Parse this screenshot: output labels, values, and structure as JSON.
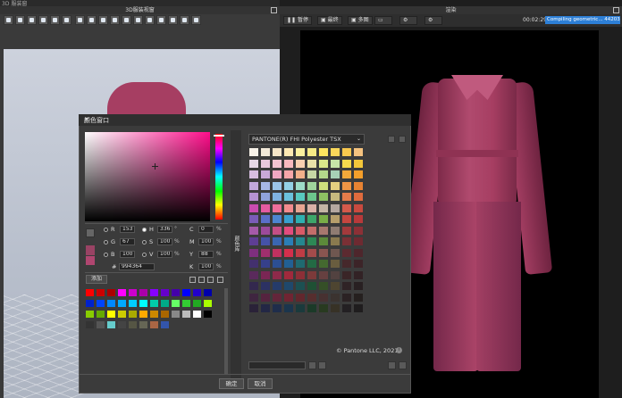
{
  "app": {
    "title": "3D 服装窗"
  },
  "windows": {
    "left_title": "3D服装视窗",
    "render_title": "渲染"
  },
  "render_toolbar": {
    "pause": "暂停",
    "final": "最终",
    "multi": "多图",
    "time": "00:02:29",
    "status": "Compiling geometric... 44203/44203"
  },
  "dialog": {
    "title": "颜色窗口",
    "close": "✕",
    "hsv": {
      "r_label": "R",
      "r": "153",
      "g_label": "G",
      "g": "67",
      "b_label": "B",
      "b": "100",
      "h_label": "H",
      "h": "336",
      "s_label": "S",
      "s": "100",
      "v_label": "V",
      "v": "100"
    },
    "cmyk": {
      "c_label": "C",
      "c": "0",
      "m_label": "M",
      "m": "100",
      "y_label": "Y",
      "y": "88",
      "k_label": "K",
      "k": "100"
    },
    "pct": "%",
    "hash": "#",
    "hex": "994364",
    "add": "添加",
    "ok": "确定",
    "cancel": "取消",
    "side_tab": "颜色库",
    "pantone_library": "PANTONE(R) FHI Polyester TSX",
    "pantone_copyright": "© Pantone LLC, 2021",
    "info_glyph": "i"
  },
  "colors": {
    "current": "#994364",
    "previous": "#b04670",
    "accent_blue": "#2d7fd6"
  },
  "swatches": [
    "#ff0000",
    "#cc0000",
    "#aa0000",
    "#ff00ff",
    "#cc00cc",
    "#aa00aa",
    "#8800ff",
    "#6600cc",
    "#4400aa",
    "#0000ff",
    "#2200cc",
    "#0000aa",
    "#0022cc",
    "#0044ff",
    "#0088ff",
    "#00aaff",
    "#00ccff",
    "#00ffff",
    "#00ccaa",
    "#00aa88",
    "#66ff66",
    "#33cc33",
    "#22aa22",
    "#aaff00",
    "#88cc00",
    "#66aa00",
    "#ffff00",
    "#cccc00",
    "#aaaa00",
    "#ffaa00",
    "#cc8800",
    "#aa6600",
    "#888888",
    "#bbbbbb",
    "#ffffff",
    "#000000",
    "#333333",
    "#555555",
    "#66cccc",
    "#444444",
    "#555544",
    "#666655",
    "#aa6644",
    "#3355aa"
  ],
  "pantone": [
    "#f7f2e8",
    "#f2e9d8",
    "#f6e6c8",
    "#fde9b2",
    "#fbf09e",
    "#f6ea86",
    "#fde55f",
    "#fbd85a",
    "#f8c84e",
    "#f5c37f",
    "#e6d8e6",
    "#e9c8dc",
    "#f2c4d2",
    "#f7b8be",
    "#f8cfb0",
    "#e9e0a8",
    "#dbe88a",
    "#c6e5a8",
    "#f6d94d",
    "#f3c73a",
    "#d7bde0",
    "#c9a9d8",
    "#efa8c2",
    "#f6a6a9",
    "#f2b08a",
    "#c7d7a5",
    "#b4d88b",
    "#a7d1b6",
    "#f4a93a",
    "#f59f2a",
    "#c2a9dc",
    "#a7b7e5",
    "#9bc4e8",
    "#93d0e6",
    "#9ddcc8",
    "#a0d59c",
    "#cfe07d",
    "#e4cf80",
    "#f09545",
    "#e88332",
    "#b592d2",
    "#8fa2db",
    "#7fb2e0",
    "#6bc0dc",
    "#58c8c0",
    "#6cc48c",
    "#8dc163",
    "#c7b97e",
    "#e57b4a",
    "#df6b3d",
    "#c94bb0",
    "#e45ba1",
    "#ee6e9a",
    "#f28b8e",
    "#e8a592",
    "#d8b0a6",
    "#c4b5a5",
    "#b4a7a0",
    "#d35a4b",
    "#c94a3f",
    "#7a5cb8",
    "#5a6fc8",
    "#4c86d0",
    "#38a0d0",
    "#2fb0b0",
    "#3da66a",
    "#79ae47",
    "#b69e6b",
    "#c6463f",
    "#b8393a",
    "#a55aa8",
    "#9c4a9a",
    "#c44f85",
    "#e24c7e",
    "#d95a67",
    "#c46d6a",
    "#a8786e",
    "#8f7c72",
    "#a33a3c",
    "#8c3036",
    "#5e3e94",
    "#4552a8",
    "#3a66b2",
    "#2b7eb6",
    "#25878f",
    "#2d8855",
    "#5c8a3a",
    "#8a7a4f",
    "#7b3035",
    "#6e2a31",
    "#7e2f7e",
    "#a12f6e",
    "#c03160",
    "#d42f4c",
    "#c03c45",
    "#a44b4b",
    "#8a5550",
    "#6f5750",
    "#5c2a30",
    "#4e262c",
    "#43306e",
    "#36408a",
    "#2c4f92",
    "#226094",
    "#1f6a70",
    "#236a44",
    "#44692f",
    "#695d3f",
    "#46282b",
    "#3c2428",
    "#5a2a5c",
    "#7a2654",
    "#8e2a4a",
    "#a0293c",
    "#8c2f37",
    "#7c3a3a",
    "#664040",
    "#524240",
    "#3a2527",
    "#322225",
    "#33284e",
    "#2c3163",
    "#253b6a",
    "#1f486c",
    "#1c5052",
    "#1f5034",
    "#354f27",
    "#4e4531",
    "#2f2326",
    "#282022",
    "#3f2540",
    "#55233f",
    "#63253a",
    "#702432",
    "#62272d",
    "#562e2e",
    "#473131",
    "#3b3330",
    "#2b2224",
    "#25201f",
    "#2a2238",
    "#232745",
    "#1f2d4b",
    "#1b354d",
    "#1a3a3c",
    "#1b3a28",
    "#283a20",
    "#373226",
    "#232023",
    "#1f1d1e"
  ]
}
